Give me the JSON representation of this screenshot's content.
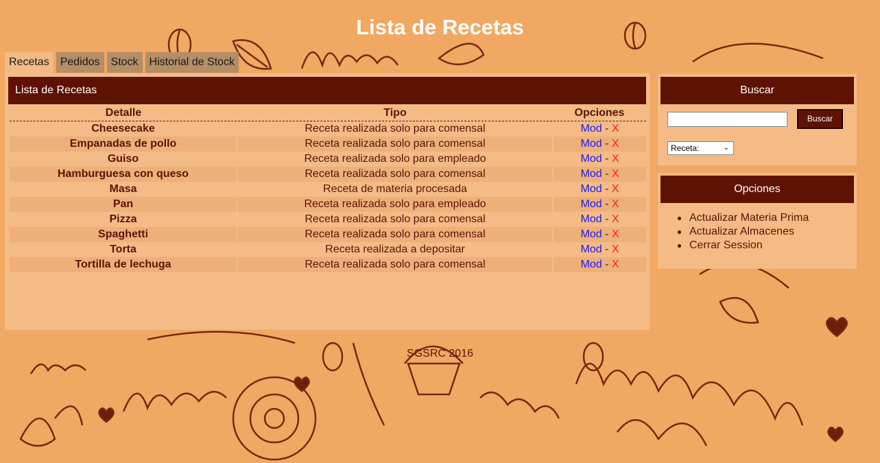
{
  "page": {
    "title": "Lista de Recetas"
  },
  "tabs": [
    {
      "label": "Recetas",
      "active": true
    },
    {
      "label": "Pedidos",
      "active": false
    },
    {
      "label": "Stock",
      "active": false
    },
    {
      "label": "Historial de Stock",
      "active": false
    }
  ],
  "main": {
    "header": "Lista de Recetas",
    "columns": {
      "detalle": "Detalle",
      "tipo": "Tipo",
      "opciones": "Opciones"
    },
    "mod_label": "Mod",
    "sep_label": "-",
    "delete_label": "X",
    "rows": [
      {
        "detalle": "Cheesecake",
        "tipo": "Receta realizada solo para comensal"
      },
      {
        "detalle": "Empanadas de pollo",
        "tipo": "Receta realizada solo para comensal"
      },
      {
        "detalle": "Guiso",
        "tipo": "Receta realizada solo para empleado"
      },
      {
        "detalle": "Hamburguesa con queso",
        "tipo": "Receta realizada solo para comensal"
      },
      {
        "detalle": "Masa",
        "tipo": "Receta de materia procesada"
      },
      {
        "detalle": "Pan",
        "tipo": "Receta realizada solo para empleado"
      },
      {
        "detalle": "Pizza",
        "tipo": "Receta realizada solo para comensal"
      },
      {
        "detalle": "Spaghetti",
        "tipo": "Receta realizada solo para comensal"
      },
      {
        "detalle": "Torta",
        "tipo": "Receta realizada a depositar"
      },
      {
        "detalle": "Tortilla de lechuga",
        "tipo": "Receta realizada solo para comensal"
      }
    ]
  },
  "search": {
    "header": "Buscar",
    "input_value": "",
    "button_label": "Buscar",
    "select_value": "Receta:"
  },
  "options": {
    "header": "Opciones",
    "items": [
      "Actualizar Materia Prima",
      "Actualizar Almacenes",
      "Cerrar Session"
    ]
  },
  "footer": {
    "text": "SGSRC 2016"
  },
  "colors": {
    "header_bg": "#5e1203",
    "panel_bg": "#f4bb86",
    "background": "#f1a862",
    "link_blue": "#1a1aff",
    "delete_red": "#ff1a1a"
  }
}
